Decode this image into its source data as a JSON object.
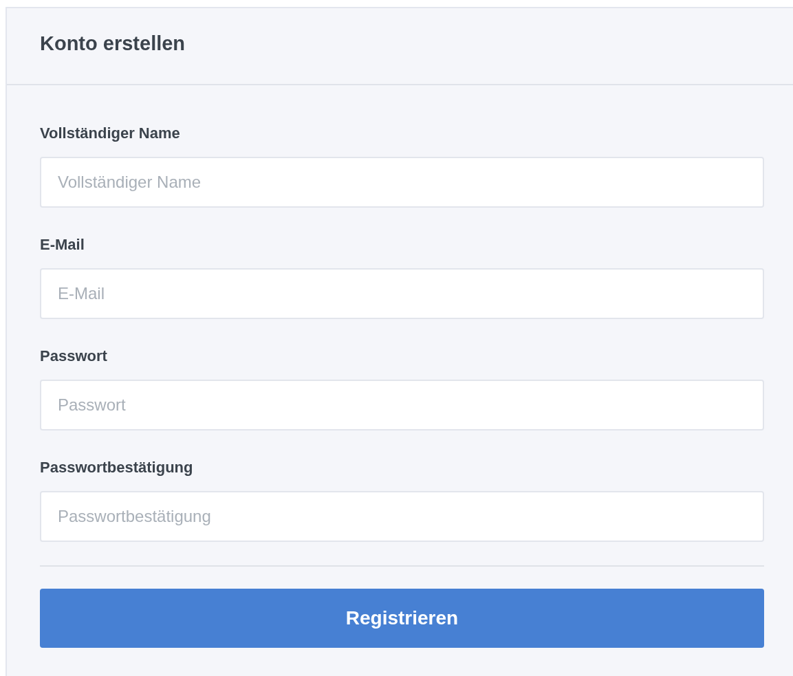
{
  "card": {
    "title": "Konto erstellen"
  },
  "fields": [
    {
      "label": "Vollständiger Name",
      "placeholder": "Vollständiger Name"
    },
    {
      "label": "E-Mail",
      "placeholder": "E-Mail"
    },
    {
      "label": "Passwort",
      "placeholder": "Passwort"
    },
    {
      "label": "Passwortbestätigung",
      "placeholder": "Passwortbestätigung"
    }
  ],
  "submit_button": "Registrieren"
}
